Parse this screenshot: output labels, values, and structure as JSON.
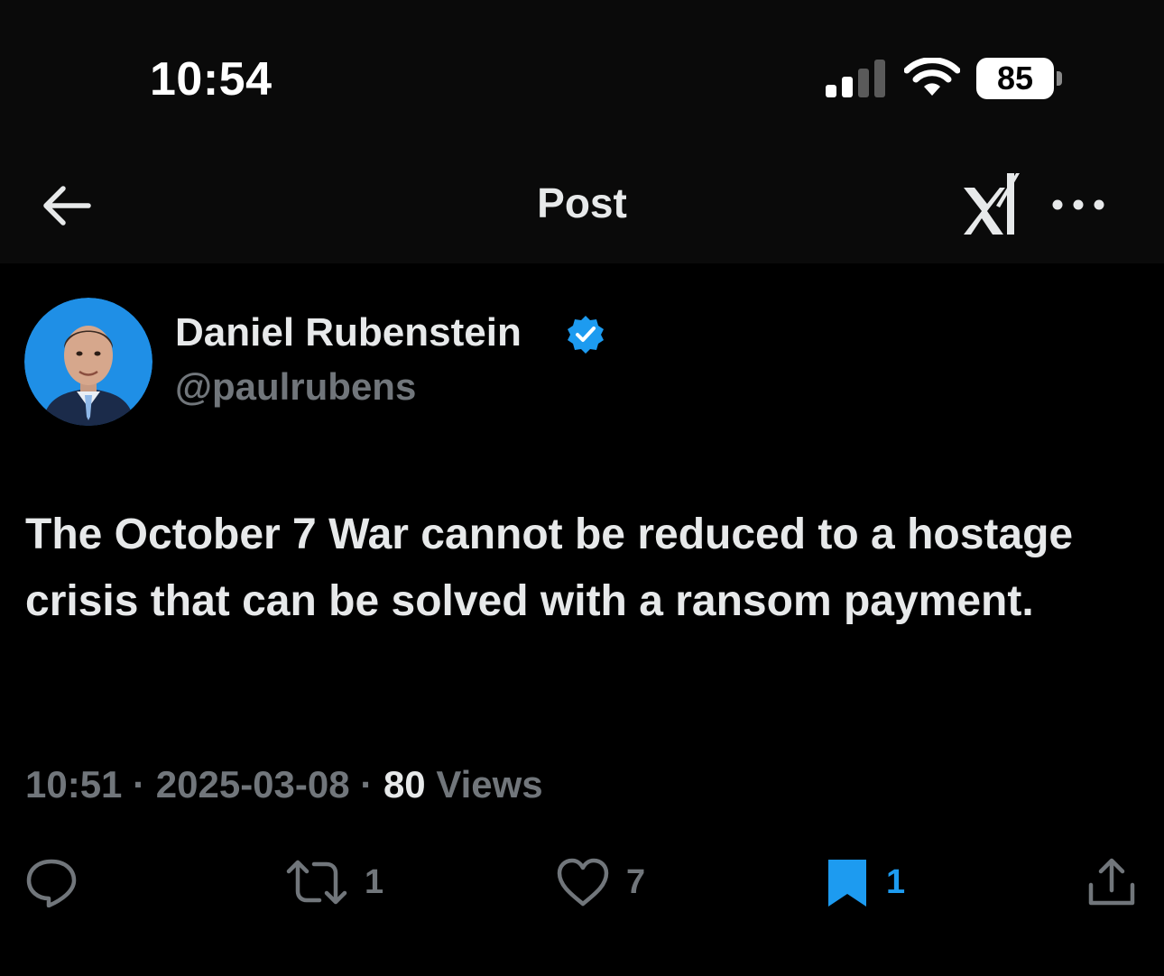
{
  "status_bar": {
    "time": "10:54",
    "battery": "85",
    "icons": [
      "cellular-signal-icon",
      "wifi-icon",
      "battery-icon"
    ]
  },
  "header": {
    "title": "Post",
    "icons": [
      "back-arrow-icon",
      "xai-logo-icon",
      "more-options-icon"
    ]
  },
  "author": {
    "display_name": "Daniel Rubenstein",
    "handle": "@paulrubens",
    "verified": true
  },
  "post": {
    "text": "The October 7 War cannot be reduced to a hostage crisis that can be solved with a ransom payment.",
    "time": "10:51",
    "separator": "·",
    "date": "2025-03-08",
    "views_count": "80",
    "views_label": "Views"
  },
  "actions": {
    "reply_count": "",
    "repost_count": "1",
    "like_count": "7",
    "bookmark_count": "1",
    "icons": [
      "reply-icon",
      "repost-icon",
      "heart-icon",
      "bookmark-icon",
      "share-icon"
    ]
  },
  "colors": {
    "background": "#000000",
    "header_background": "#0a0a0a",
    "primary_text": "#e7e9ea",
    "secondary_text": "#71767b",
    "accent": "#1d9bf0"
  }
}
